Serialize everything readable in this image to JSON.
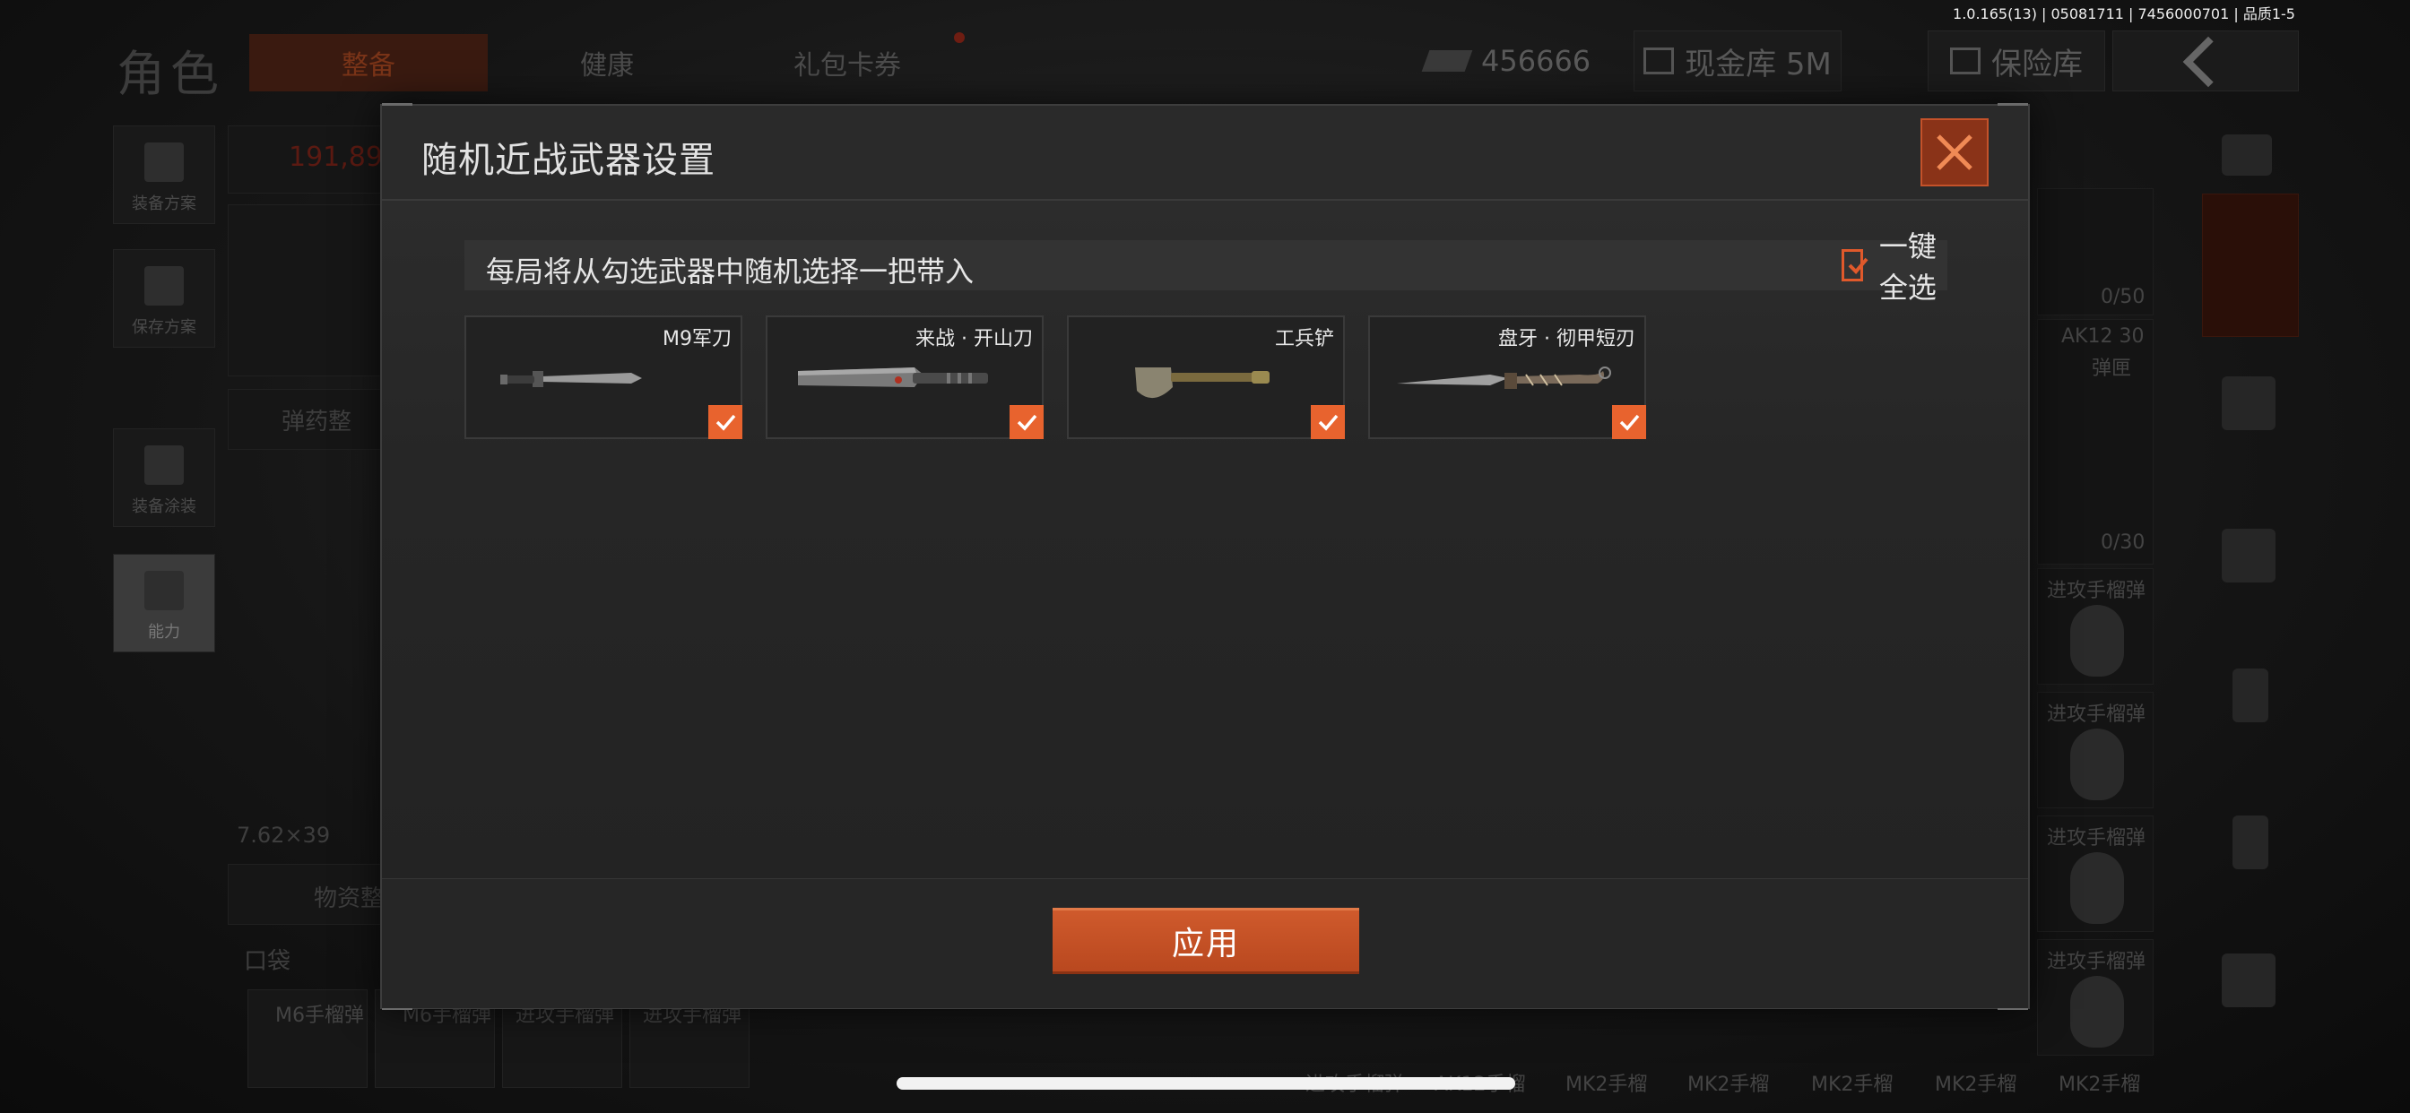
{
  "version": "1.0.165(13) | 05081711 | 7456000701 | 品质1-5",
  "background": {
    "title": "角色",
    "tabs": [
      "整备",
      "健康",
      "礼包卡券"
    ],
    "money": "456666",
    "cash_vault": "现金库 5M",
    "safe_vault": "保险库",
    "side_buttons": [
      "装备方案",
      "保存方案",
      "装备涂装",
      "能力"
    ],
    "armor_value": "191,89",
    "ammo_label": "弹药整",
    "caliber": "7.62×39",
    "supply_label": "物资整",
    "pocket_label": "口袋",
    "counter_1": "0/50",
    "counter_2": "0/30",
    "ak_label": "AK12 30",
    "ak_sub": "弹匣",
    "grenade_label": "进攻手榴弹",
    "bottom_labels": [
      "进攻手榴弹",
      "AK12手榴",
      "MK2手榴",
      "MK2手榴",
      "MK2手榴",
      "MK2手榴",
      "MK2手榴"
    ],
    "pocket_items": [
      "M6手榴弹",
      "M6手榴弹",
      "进攻手榴弹",
      "进攻手榴弹"
    ]
  },
  "modal": {
    "title": "随机近战武器设置",
    "info": "每局将从勾选武器中随机选择一把带入",
    "select_all": "一键全选",
    "weapons": [
      {
        "name": "M9军刀",
        "checked": true
      },
      {
        "name": "来战 · 开山刀",
        "checked": true
      },
      {
        "name": "工兵铲",
        "checked": true
      },
      {
        "name": "盘牙 · 彻甲短刃",
        "checked": true
      }
    ],
    "apply": "应用"
  },
  "colors": {
    "accent": "#e8632e",
    "close": "#8a3318"
  }
}
